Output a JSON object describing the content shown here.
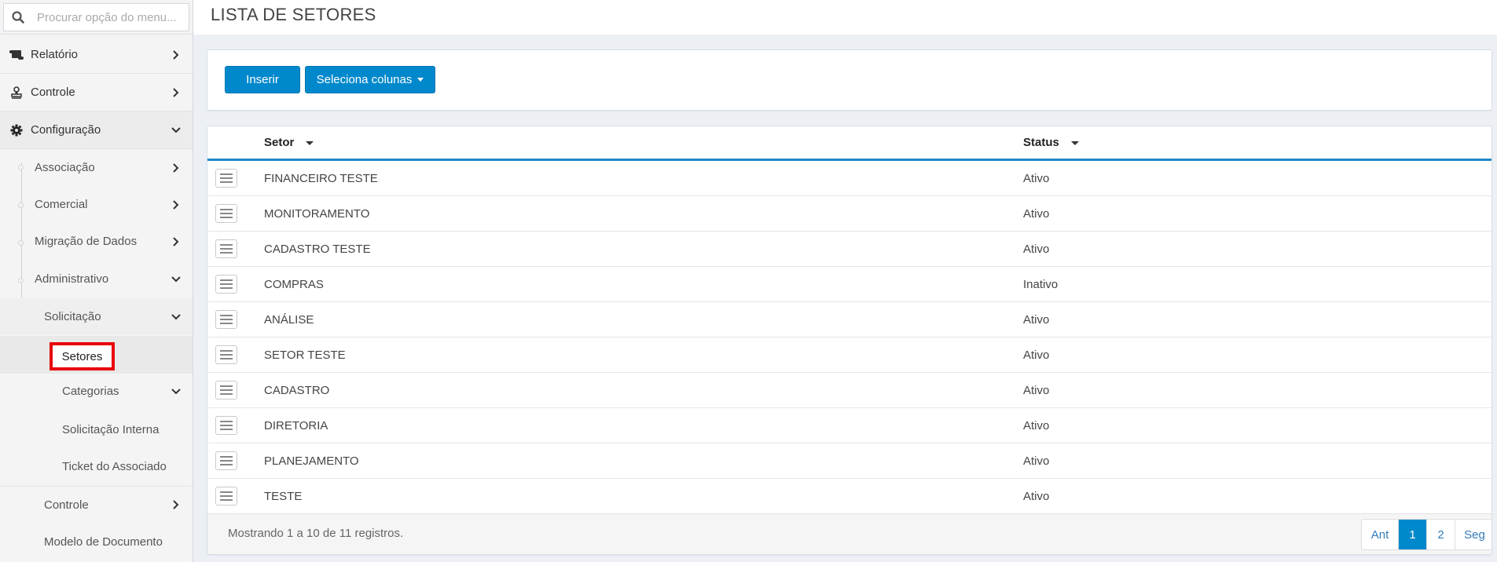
{
  "search": {
    "placeholder": "Procurar opção do menu..."
  },
  "menu": {
    "relatorio": "Relatório",
    "controle": "Controle",
    "configuracao": "Configuração",
    "associacao": "Associação",
    "comercial": "Comercial",
    "migracao": "Migração de Dados",
    "administrativo": "Administrativo",
    "solicitacao": "Solicitação",
    "setores": "Setores",
    "categorias": "Categorias",
    "solicitacao_interna": "Solicitação Interna",
    "ticket_associado": "Ticket do Associado",
    "controle_sub": "Controle",
    "modelo_documento": "Modelo de Documento"
  },
  "page": {
    "title": "LISTA DE SETORES"
  },
  "toolbar": {
    "insert_label": "Inserir",
    "columns_label": "Seleciona colunas"
  },
  "table": {
    "headers": [
      "Setor",
      "Status"
    ],
    "rows": [
      {
        "setor": "FINANCEIRO TESTE",
        "status": "Ativo"
      },
      {
        "setor": "MONITORAMENTO",
        "status": "Ativo"
      },
      {
        "setor": "CADASTRO TESTE",
        "status": "Ativo"
      },
      {
        "setor": "COMPRAS",
        "status": "Inativo"
      },
      {
        "setor": "ANÁLISE",
        "status": "Ativo"
      },
      {
        "setor": "SETOR TESTE",
        "status": "Ativo"
      },
      {
        "setor": "CADASTRO",
        "status": "Ativo"
      },
      {
        "setor": "DIRETORIA",
        "status": "Ativo"
      },
      {
        "setor": "PLANEJAMENTO",
        "status": "Ativo"
      },
      {
        "setor": "TESTE",
        "status": "Ativo"
      }
    ]
  },
  "footer": {
    "info": "Mostrando 1 a 10 de 11 registros."
  },
  "pagination": {
    "prev": "Ant",
    "pages": [
      "1",
      "2"
    ],
    "next": "Seg",
    "current": "1"
  },
  "colors": {
    "primary": "#0088cc",
    "highlight": "#e8000b",
    "header_border": "#1e88c7"
  }
}
